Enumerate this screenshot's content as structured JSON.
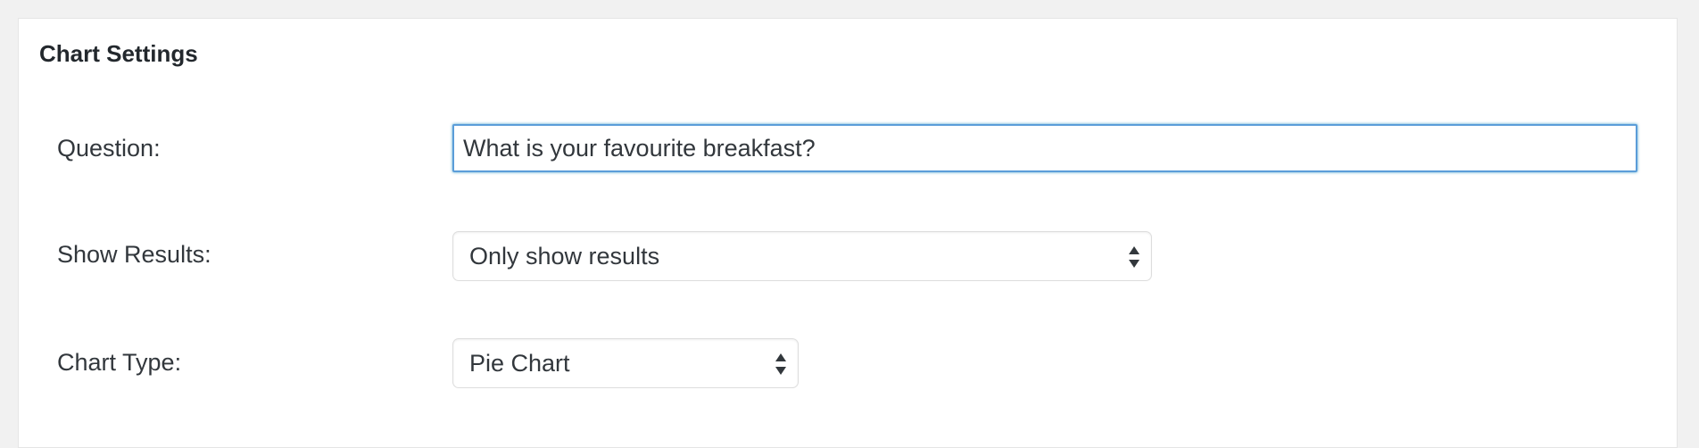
{
  "panel": {
    "title": "Chart Settings"
  },
  "question": {
    "label": "Question:",
    "value": "What is your favourite breakfast?"
  },
  "show_results": {
    "label": "Show Results:",
    "selected": "Only show results"
  },
  "chart_type": {
    "label": "Chart Type:",
    "selected": "Pie Chart"
  },
  "icons": {
    "select_arrows": "up-down-arrows-icon"
  }
}
